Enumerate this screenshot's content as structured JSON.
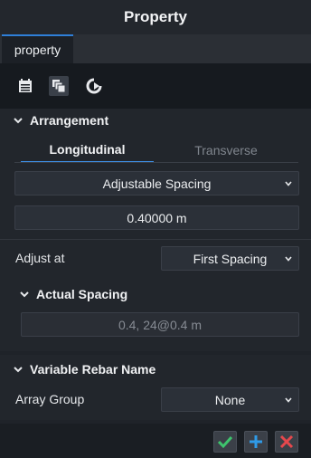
{
  "window": {
    "title": "Property"
  },
  "tabs": [
    {
      "label": "property"
    }
  ],
  "toolbar": {
    "icons": [
      "calendar-icon",
      "layers-icon",
      "refresh-icon"
    ]
  },
  "arrangement": {
    "title": "Arrangement",
    "segments": {
      "longitudinal": "Longitudinal",
      "transverse": "Transverse"
    },
    "spacing_mode": "Adjustable Spacing",
    "spacing_value": "0.40000 m",
    "adjust_label": "Adjust at",
    "adjust_value": "First Spacing",
    "actual_spacing_title": "Actual Spacing",
    "actual_spacing_value": "0.4, 24@0.4  m"
  },
  "variable_rebar": {
    "title": "Variable Rebar Name",
    "array_group_label": "Array Group",
    "array_group_value": "None"
  },
  "footer": {
    "buttons": [
      "check-icon",
      "plus-icon",
      "close-icon"
    ]
  },
  "colors": {
    "accent": "#3d8fe6",
    "confirm": "#3ec46d",
    "add": "#2f9be8",
    "cancel": "#e5484d"
  }
}
